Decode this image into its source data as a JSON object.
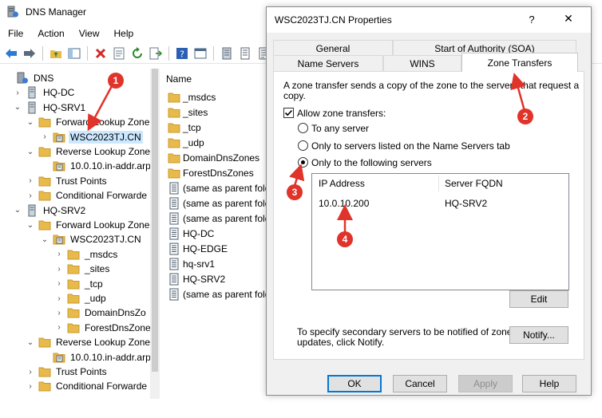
{
  "app": {
    "title": "DNS Manager",
    "menu": [
      "File",
      "Action",
      "View",
      "Help"
    ]
  },
  "tree": {
    "items": [
      {
        "label": "DNS",
        "icon": "dns-icon",
        "level": 0,
        "twisty": ""
      },
      {
        "label": "HQ-DC",
        "icon": "server-icon",
        "level": 1,
        "twisty": "›"
      },
      {
        "label": "HQ-SRV1",
        "icon": "server-icon",
        "level": 1,
        "twisty": "⌄"
      },
      {
        "label": "Forward Lookup Zone",
        "icon": "folder-icon",
        "level": 2,
        "twisty": "⌄"
      },
      {
        "label": "WSC2023TJ.CN",
        "icon": "zone-icon",
        "level": 3,
        "twisty": "›",
        "selected": true
      },
      {
        "label": "Reverse Lookup Zone",
        "icon": "folder-icon",
        "level": 2,
        "twisty": "⌄"
      },
      {
        "label": "10.0.10.in-addr.arp",
        "icon": "zone-icon",
        "level": 3,
        "twisty": ""
      },
      {
        "label": "Trust Points",
        "icon": "folder-icon",
        "level": 2,
        "twisty": "›"
      },
      {
        "label": "Conditional Forwarde",
        "icon": "folder-icon",
        "level": 2,
        "twisty": "›"
      },
      {
        "label": "HQ-SRV2",
        "icon": "server-icon",
        "level": 1,
        "twisty": "⌄"
      },
      {
        "label": "Forward Lookup Zone",
        "icon": "folder-icon",
        "level": 2,
        "twisty": "⌄"
      },
      {
        "label": "WSC2023TJ.CN",
        "icon": "zone-icon",
        "level": 3,
        "twisty": "⌄"
      },
      {
        "label": "_msdcs",
        "icon": "folder-icon",
        "level": 4,
        "twisty": "›"
      },
      {
        "label": "_sites",
        "icon": "folder-icon",
        "level": 4,
        "twisty": "›"
      },
      {
        "label": "_tcp",
        "icon": "folder-icon",
        "level": 4,
        "twisty": "›"
      },
      {
        "label": "_udp",
        "icon": "folder-icon",
        "level": 4,
        "twisty": "›"
      },
      {
        "label": "DomainDnsZo",
        "icon": "folder-icon",
        "level": 4,
        "twisty": "›"
      },
      {
        "label": "ForestDnsZone",
        "icon": "folder-icon",
        "level": 4,
        "twisty": "›"
      },
      {
        "label": "Reverse Lookup Zone",
        "icon": "folder-icon",
        "level": 2,
        "twisty": "⌄"
      },
      {
        "label": "10.0.10.in-addr.arp",
        "icon": "zone-icon",
        "level": 3,
        "twisty": ""
      },
      {
        "label": "Trust Points",
        "icon": "folder-icon",
        "level": 2,
        "twisty": "›"
      },
      {
        "label": "Conditional Forwarde",
        "icon": "folder-icon",
        "level": 2,
        "twisty": "›"
      }
    ]
  },
  "list": {
    "header": "Name",
    "items": [
      {
        "label": "_msdcs",
        "icon": "folder-icon"
      },
      {
        "label": "_sites",
        "icon": "folder-icon"
      },
      {
        "label": "_tcp",
        "icon": "folder-icon"
      },
      {
        "label": "_udp",
        "icon": "folder-icon"
      },
      {
        "label": "DomainDnsZones",
        "icon": "folder-icon"
      },
      {
        "label": "ForestDnsZones",
        "icon": "folder-icon"
      },
      {
        "label": "(same as parent fold",
        "icon": "record-icon"
      },
      {
        "label": "(same as parent fold",
        "icon": "record-icon"
      },
      {
        "label": "(same as parent fold",
        "icon": "record-icon"
      },
      {
        "label": "HQ-DC",
        "icon": "record-icon"
      },
      {
        "label": "HQ-EDGE",
        "icon": "record-icon"
      },
      {
        "label": "hq-srv1",
        "icon": "record-icon"
      },
      {
        "label": "HQ-SRV2",
        "icon": "record-icon"
      },
      {
        "label": "(same as parent fold",
        "icon": "record-icon"
      }
    ]
  },
  "dialog": {
    "title": "WSC2023TJ.CN Properties",
    "help": "?",
    "close": "✕",
    "tabs_row1": [
      "General",
      "Start of Authority (SOA)"
    ],
    "tabs_row2": [
      "Name Servers",
      "WINS",
      "Zone Transfers"
    ],
    "active_tab": "Zone Transfers",
    "description_line1": "A zone transfer sends a copy of the zone to the servers that request a",
    "description_line2": "copy.",
    "allow_label": "Allow zone transfers:",
    "allow_checked": true,
    "options": [
      {
        "label": "To any server",
        "selected": false
      },
      {
        "label": "Only to servers listed on the Name Servers tab",
        "selected": false
      },
      {
        "label": "Only to the following servers",
        "selected": true
      }
    ],
    "servers": {
      "columns": [
        "IP Address",
        "Server FQDN"
      ],
      "rows": [
        {
          "ip": "10.0.10.200",
          "fqdn": "HQ-SRV2"
        }
      ]
    },
    "edit_label": "Edit",
    "notify_text_line1": "To specify secondary servers to be notified of zone",
    "notify_text_line2": "updates, click Notify.",
    "notify_label": "Notify...",
    "buttons": {
      "ok": "OK",
      "cancel": "Cancel",
      "apply": "Apply",
      "help": "Help"
    }
  },
  "annotations": [
    "1",
    "2",
    "3",
    "4"
  ],
  "colors": {
    "marker": "#e0332a",
    "selection": "#cce8ff",
    "folder": "#e8b94b",
    "accent": "#0078d7"
  }
}
